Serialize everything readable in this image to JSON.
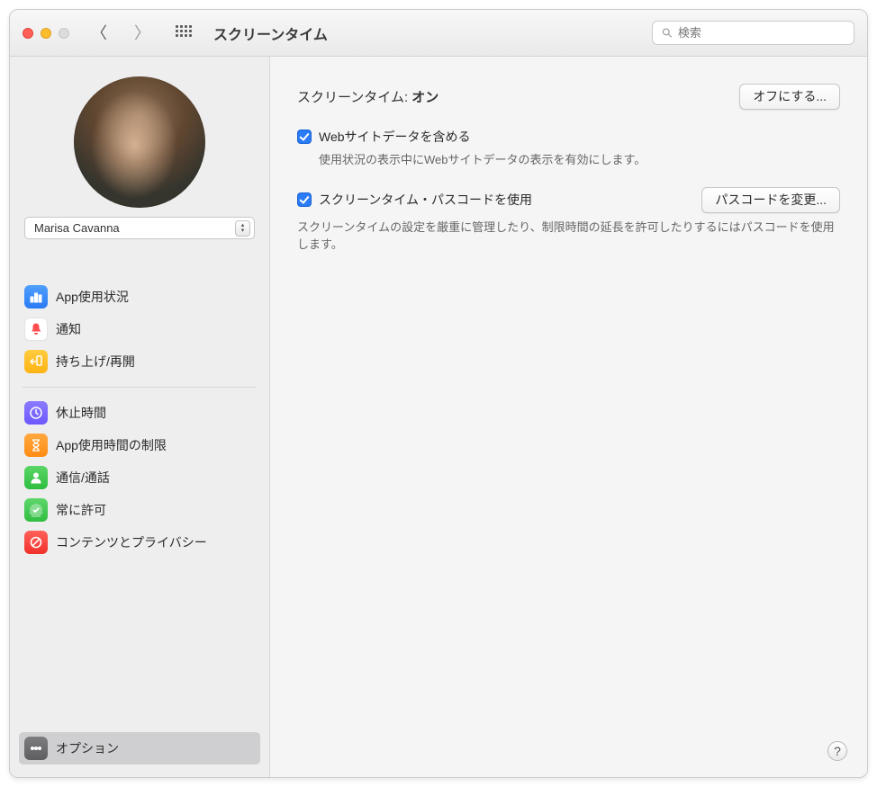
{
  "title": "スクリーンタイム",
  "search_placeholder": "検索",
  "user_name": "Marisa Cavanna",
  "sidebar": {
    "items": [
      {
        "label": "App使用状況"
      },
      {
        "label": "通知"
      },
      {
        "label": "持ち上げ/再開"
      }
    ],
    "items2": [
      {
        "label": "休止時間"
      },
      {
        "label": "App使用時間の制限"
      },
      {
        "label": "通信/通話"
      },
      {
        "label": "常に許可"
      },
      {
        "label": "コンテンツとプライバシー"
      }
    ],
    "options": "オプション"
  },
  "content": {
    "status_prefix": "スクリーンタイム: ",
    "status_value": "オン",
    "turn_off": "オフにする...",
    "include_web": {
      "label": "Webサイトデータを含める",
      "desc": "使用状況の表示中にWebサイトデータの表示を有効にします。"
    },
    "passcode": {
      "label": "スクリーンタイム・パスコードを使用",
      "button": "パスコードを変更...",
      "desc": "スクリーンタイムの設定を厳重に管理したり、制限時間の延長を許可したりするにはパスコードを使用します。"
    }
  }
}
